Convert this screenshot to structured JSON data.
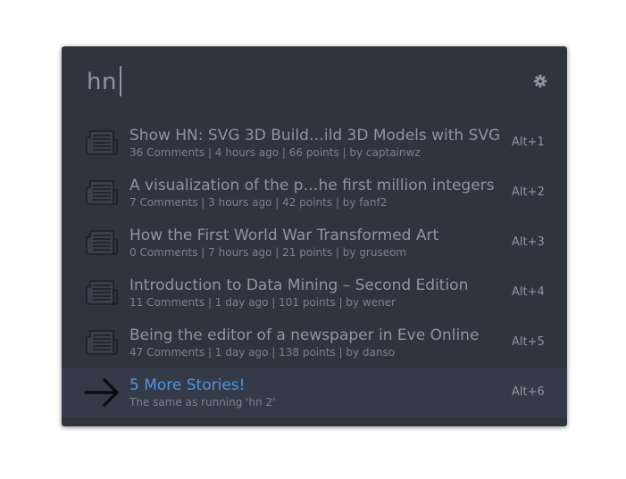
{
  "search": {
    "query": "hn"
  },
  "settings_icon": "gear-icon",
  "results": [
    {
      "icon": "newspaper-icon",
      "title": "Show HN: SVG 3D Build…ild 3D Models with SVG",
      "subtitle": "36 Comments | 4 hours ago | 66 points | by captainwz",
      "shortcut": "Alt+1"
    },
    {
      "icon": "newspaper-icon",
      "title": "A visualization of the p…he first million integers",
      "subtitle": "7 Comments | 3 hours ago | 42 points | by fanf2",
      "shortcut": "Alt+2"
    },
    {
      "icon": "newspaper-icon",
      "title": "How the First World War Transformed Art",
      "subtitle": "0 Comments | 7 hours ago | 21 points | by gruseom",
      "shortcut": "Alt+3"
    },
    {
      "icon": "newspaper-icon",
      "title": "Introduction to Data Mining – Second Edition",
      "subtitle": "11 Comments | 1 day ago | 101 points | by wener",
      "shortcut": "Alt+4"
    },
    {
      "icon": "newspaper-icon",
      "title": "Being the editor of a newspaper in Eve Online",
      "subtitle": "47 Comments | 1 day ago | 138 points | by danso",
      "shortcut": "Alt+5"
    },
    {
      "icon": "arrow-right-icon",
      "title": "5 More Stories!",
      "subtitle": "The same as running 'hn 2'",
      "shortcut": "Alt+6"
    }
  ],
  "colors": {
    "window_bg": "#2f343f",
    "selected_row_bg": "#353a48",
    "text": "#8f95a1",
    "link": "#5294e2"
  }
}
